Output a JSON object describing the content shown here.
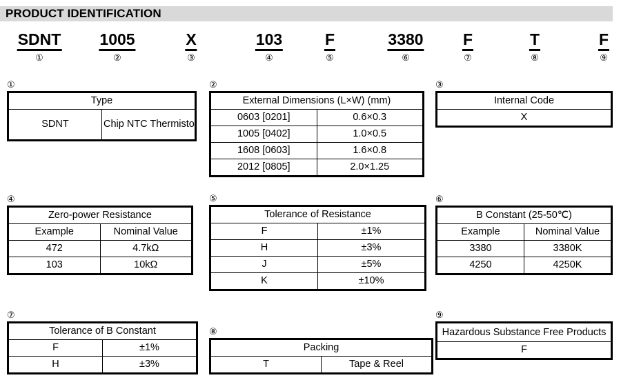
{
  "section": {
    "title": "PRODUCT IDENTIFICATION",
    "bar_color": "#d9d9d9"
  },
  "part_number": {
    "segments": [
      {
        "code": "SDNT",
        "index": "①"
      },
      {
        "code": "1005",
        "index": "②"
      },
      {
        "code": "X",
        "index": "③"
      },
      {
        "code": "103",
        "index": "④"
      },
      {
        "code": "F",
        "index": "⑤"
      },
      {
        "code": "3380",
        "index": "⑥"
      },
      {
        "code": "F",
        "index": "⑦"
      },
      {
        "code": "T",
        "index": "⑧"
      },
      {
        "code": "F",
        "index": "⑨"
      }
    ]
  },
  "blocks": {
    "b1": {
      "index": "①",
      "header": "Type",
      "rows": [
        {
          "code": "SDNT",
          "value": "Chip NTC Thermistor"
        }
      ]
    },
    "b2": {
      "index": "②",
      "header": "External Dimensions (L×W) (mm)",
      "rows": [
        {
          "code": "0603 [0201]",
          "value": "0.6×0.3"
        },
        {
          "code": "1005 [0402]",
          "value": "1.0×0.5"
        },
        {
          "code": "1608 [0603]",
          "value": "1.6×0.8"
        },
        {
          "code": "2012 [0805]",
          "value": "2.0×1.25"
        }
      ]
    },
    "b3": {
      "index": "③",
      "header": "Internal Code",
      "rows": [
        {
          "value": "X"
        }
      ]
    },
    "b4": {
      "index": "④",
      "header": "Zero-power Resistance",
      "subheader": {
        "code": "Example",
        "value": "Nominal Value"
      },
      "rows": [
        {
          "code": "472",
          "value": "4.7kΩ"
        },
        {
          "code": "103",
          "value": "10kΩ"
        }
      ]
    },
    "b5": {
      "index": "⑤",
      "header": "Tolerance of Resistance",
      "rows": [
        {
          "code": "F",
          "value": "±1%"
        },
        {
          "code": "H",
          "value": "±3%"
        },
        {
          "code": "J",
          "value": "±5%"
        },
        {
          "code": "K",
          "value": "±10%"
        }
      ]
    },
    "b6": {
      "index": "⑥",
      "header": "B Constant (25-50℃)",
      "subheader": {
        "code": "Example",
        "value": "Nominal Value"
      },
      "rows": [
        {
          "code": "3380",
          "value": "3380K"
        },
        {
          "code": "4250",
          "value": "4250K"
        }
      ]
    },
    "b7": {
      "index": "⑦",
      "header": "Tolerance of B Constant",
      "rows": [
        {
          "code": "F",
          "value": "±1%"
        },
        {
          "code": "H",
          "value": "±3%"
        }
      ]
    },
    "b8": {
      "index": "⑧",
      "header": "Packing",
      "rows": [
        {
          "code": "T",
          "value": "Tape & Reel"
        }
      ]
    },
    "b9": {
      "index": "⑨",
      "header": "Hazardous Substance Free Products",
      "rows": [
        {
          "value": "F"
        }
      ]
    }
  }
}
